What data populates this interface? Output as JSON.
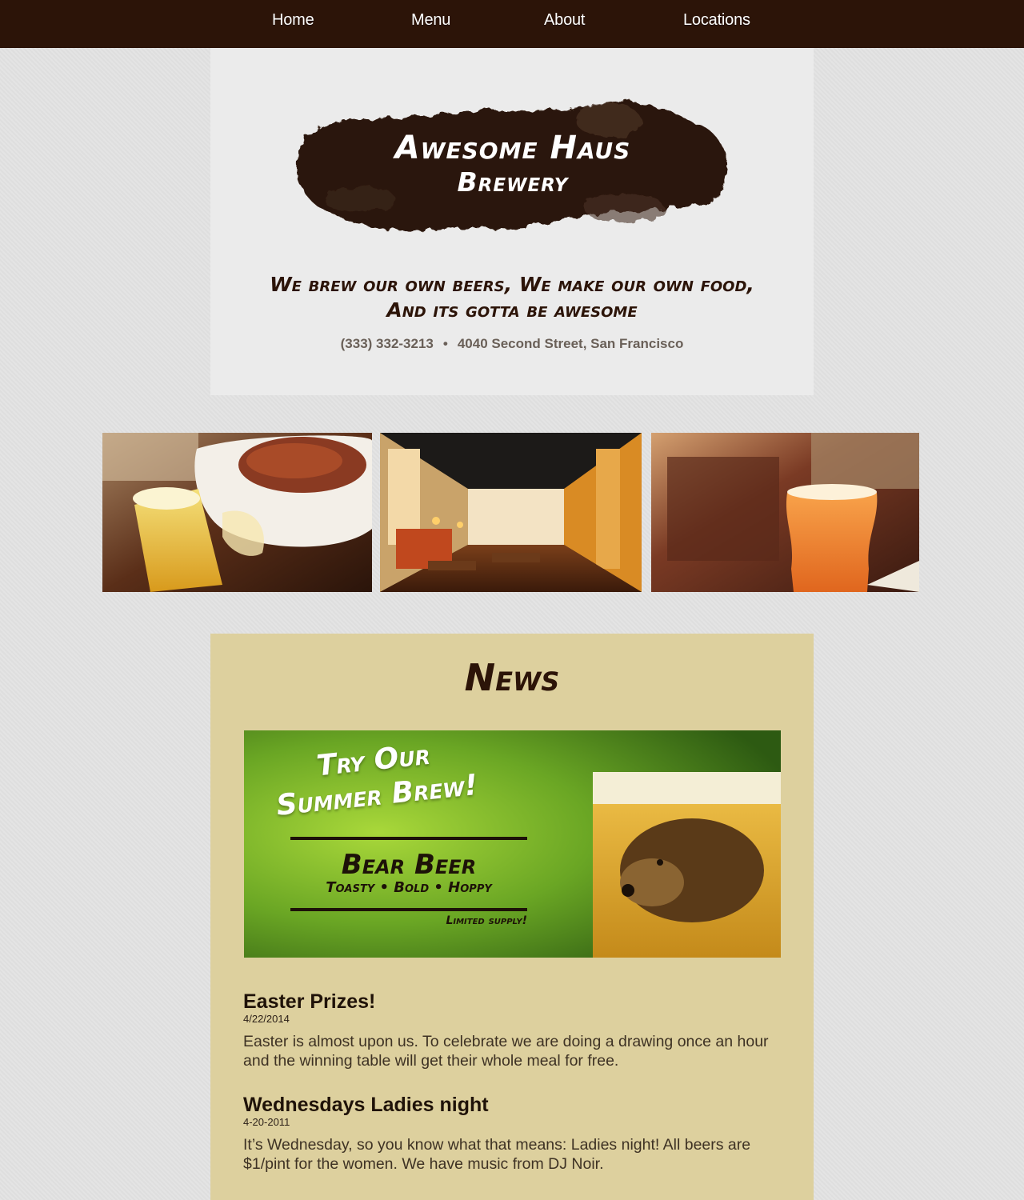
{
  "nav": {
    "items": [
      "Home",
      "Menu",
      "About",
      "Locations"
    ]
  },
  "header": {
    "logo_line1": "Awesome Haus",
    "logo_line2": "Brewery",
    "tagline_line1": "We brew our own beers, We make our own food,",
    "tagline_line2": "And its gotta be awesome",
    "phone": "(333) 332-3213",
    "separator": "•",
    "address": "4040 Second Street, San Francisco"
  },
  "news": {
    "title": "News",
    "promo": {
      "headline_line1": "Try Our",
      "headline_line2": "Summer Brew!",
      "beer_name": "Bear Beer",
      "beer_desc": "Toasty • Bold • Hoppy",
      "note": "Limited supply!"
    },
    "items": [
      {
        "title": "Easter Prizes!",
        "date": "4/22/2014",
        "body": "Easter is almost upon us. To celebrate we are doing a drawing once an hour and the winning table will get their whole meal for free."
      },
      {
        "title": "Wednesdays Ladies night",
        "date": "4-20-2011",
        "body": "It’s Wednesday, so you know what that means: Ladies night! All beers are $1/pint for the women. We have music from DJ Noir."
      }
    ]
  },
  "colors": {
    "nav_bg": "#2c1408",
    "news_bg": "#ddd09e",
    "header_bg": "#ebebeb",
    "text_dark": "#2c1408"
  }
}
